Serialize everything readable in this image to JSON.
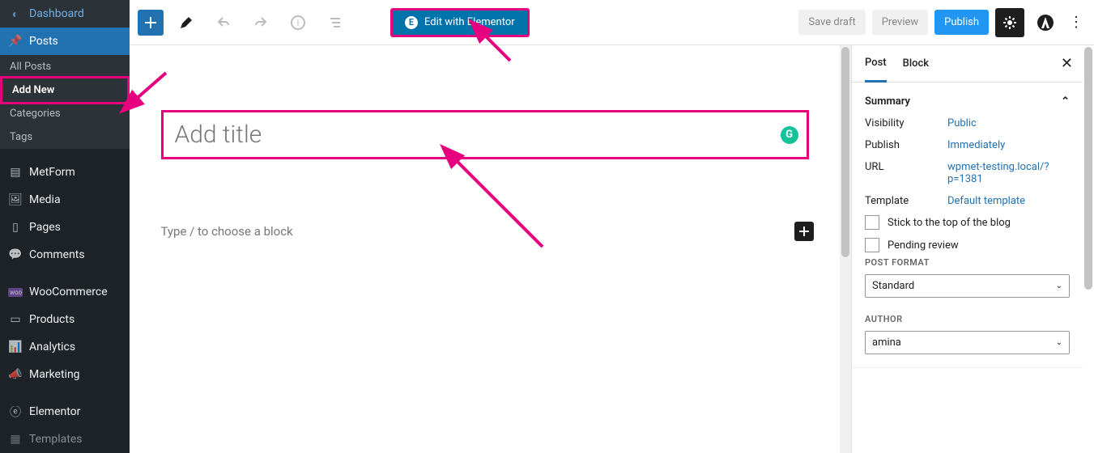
{
  "sidebar": {
    "dashboard": "Dashboard",
    "posts": "Posts",
    "submenu": {
      "all": "All Posts",
      "add": "Add New",
      "cats": "Categories",
      "tags": "Tags"
    },
    "metform": "MetForm",
    "media": "Media",
    "pages": "Pages",
    "comments": "Comments",
    "woo": "WooCommerce",
    "products": "Products",
    "analytics": "Analytics",
    "marketing": "Marketing",
    "elementor": "Elementor",
    "templates": "Templates"
  },
  "toolbar": {
    "elementor_btn": "Edit with Elementor",
    "save_draft": "Save draft",
    "preview": "Preview",
    "publish": "Publish"
  },
  "canvas": {
    "title_placeholder": "Add title",
    "block_prompt": "Type / to choose a block"
  },
  "settings": {
    "tab_post": "Post",
    "tab_block": "Block",
    "summary_label": "Summary",
    "visibility": {
      "k": "Visibility",
      "v": "Public"
    },
    "publish": {
      "k": "Publish",
      "v": "Immediately"
    },
    "url": {
      "k": "URL",
      "v": "wpmet-testing.local/?p=1381"
    },
    "template": {
      "k": "Template",
      "v": "Default template"
    },
    "stick_top": "Stick to the top of the blog",
    "pending": "Pending review",
    "post_format_lbl": "POST FORMAT",
    "post_format_val": "Standard",
    "author_lbl": "AUTHOR",
    "author_val": "amina"
  }
}
